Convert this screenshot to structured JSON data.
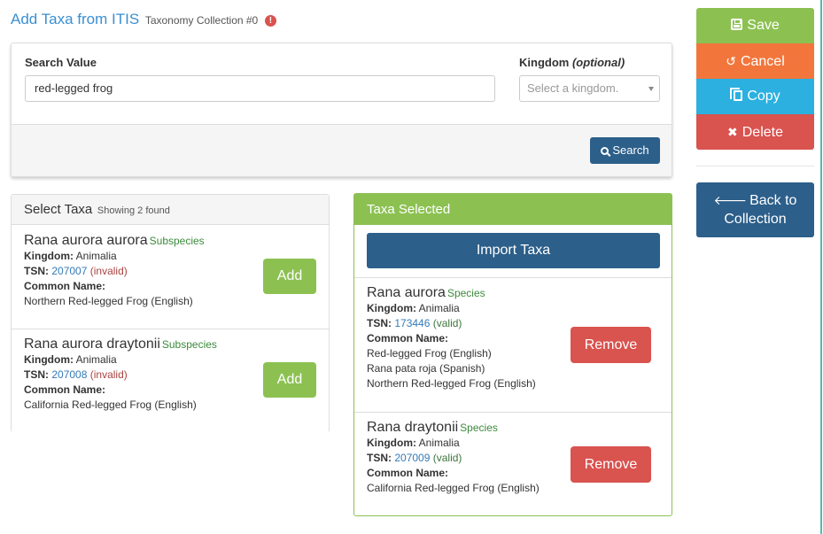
{
  "header": {
    "title": "Add Taxa from ITIS",
    "subtitle": "Taxonomy Collection #0",
    "warning_glyph": "!"
  },
  "search": {
    "value_label": "Search Value",
    "value": "red-legged frog",
    "kingdom_label": "Kingdom",
    "kingdom_optional": "(optional)",
    "kingdom_placeholder": "Select a kingdom.",
    "search_button": "Search"
  },
  "select_taxa": {
    "title": "Select Taxa",
    "count_text": "Showing 2 found",
    "items": [
      {
        "name": "Rana aurora aurora",
        "rank": "Subspecies",
        "kingdom_label": "Kingdom:",
        "kingdom": "Animalia",
        "tsn_label": "TSN:",
        "tsn": "207007",
        "status": "(invalid)",
        "common_label": "Common Name:",
        "common_names": [
          "Northern Red-legged Frog (English)"
        ],
        "add_label": "Add"
      },
      {
        "name": "Rana aurora draytonii",
        "rank": "Subspecies",
        "kingdom_label": "Kingdom:",
        "kingdom": "Animalia",
        "tsn_label": "TSN:",
        "tsn": "207008",
        "status": "(invalid)",
        "common_label": "Common Name:",
        "common_names": [
          "California Red-legged Frog (English)"
        ],
        "add_label": "Add"
      }
    ]
  },
  "taxa_selected": {
    "title": "Taxa Selected",
    "import_button": "Import Taxa",
    "items": [
      {
        "name": "Rana aurora",
        "rank": "Species",
        "kingdom_label": "Kingdom:",
        "kingdom": "Animalia",
        "tsn_label": "TSN:",
        "tsn": "173446",
        "status": "(valid)",
        "common_label": "Common Name:",
        "common_names": [
          "Red-legged Frog (English)",
          "Rana pata roja (Spanish)",
          "Northern Red-legged Frog (English)"
        ],
        "remove_label": "Remove"
      },
      {
        "name": "Rana draytonii",
        "rank": "Species",
        "kingdom_label": "Kingdom:",
        "kingdom": "Animalia",
        "tsn_label": "TSN:",
        "tsn": "207009",
        "status": "(valid)",
        "common_label": "Common Name:",
        "common_names": [
          "California Red-legged Frog (English)"
        ],
        "remove_label": "Remove"
      }
    ]
  },
  "sidebar": {
    "save": "Save",
    "cancel": "Cancel",
    "copy": "Copy",
    "delete": "Delete",
    "back_line1": "Back to",
    "back_line2": "Collection"
  },
  "colors": {
    "green": "#8cc152",
    "orange": "#f2763c",
    "cyan": "#2bb0e0",
    "red": "#d9534f",
    "navy": "#2c5f8a",
    "link_blue": "#3a8fd1"
  },
  "icons": {
    "title_warning": "exclamation-circle-icon",
    "search": "search-icon",
    "save": "floppy-disk-icon",
    "cancel": "undo-icon",
    "copy": "copy-icon",
    "delete": "times-icon",
    "back": "arrow-left-icon",
    "select_caret": "caret-down-icon"
  }
}
